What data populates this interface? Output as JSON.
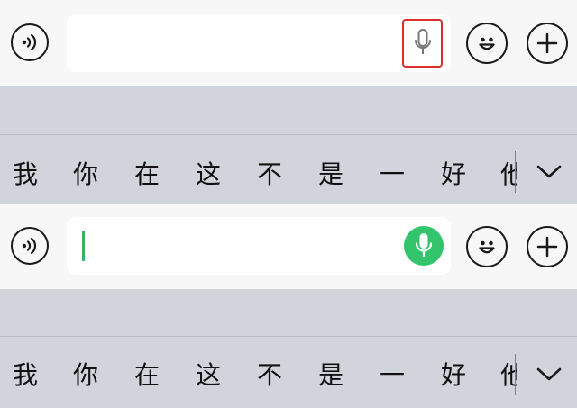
{
  "candidates": [
    "我",
    "你",
    "在",
    "这",
    "不",
    "是",
    "一",
    "好",
    "他"
  ],
  "colors": {
    "bar_bg": "#f7f7f7",
    "keyboard_bg": "#d1d4db",
    "highlight_border": "#d7312c",
    "mic_active": "#34c46b",
    "cursor": "#3bb263"
  },
  "icons": {
    "voice_toggle": "voice-wave-icon",
    "mic": "microphone-icon",
    "emoji": "smiley-icon",
    "add": "plus-icon",
    "expand": "chevron-down-icon"
  },
  "states": [
    {
      "mic_style": "outlined-highlighted",
      "input_focused": false
    },
    {
      "mic_style": "green-filled",
      "input_focused": true
    }
  ]
}
